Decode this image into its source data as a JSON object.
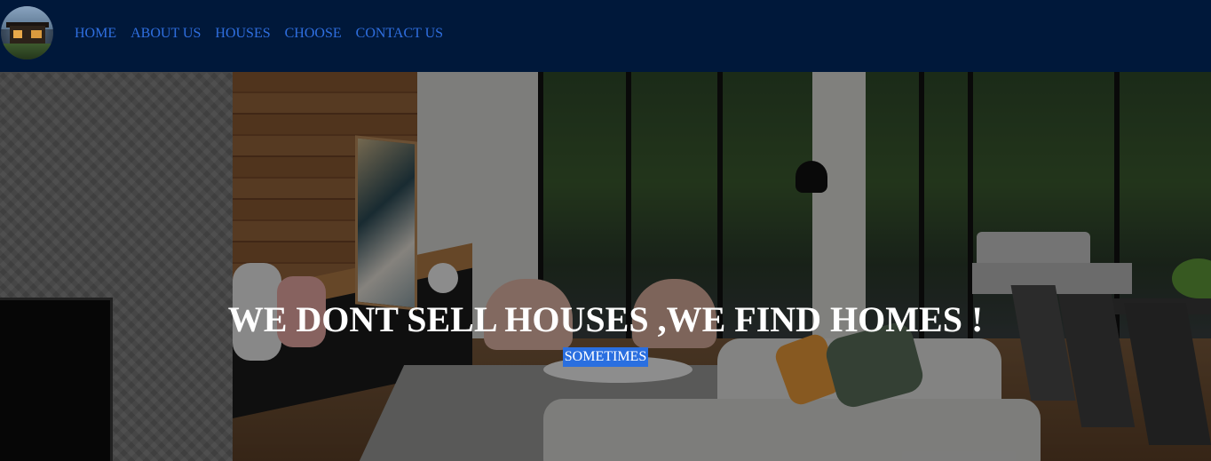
{
  "nav": {
    "logo_icon": "house-logo",
    "links": [
      "HOME",
      "ABOUT US",
      "HOUSES",
      "CHOOSE",
      "CONTACT US"
    ]
  },
  "hero": {
    "title": "WE DONT SELL HOUSES ,WE FIND HOMES !",
    "badge": "SOMETIMES"
  },
  "colors": {
    "navbar": "#00183a",
    "link": "#2f6fe0",
    "badge": "#2a6fe0",
    "title": "#ffffff"
  }
}
